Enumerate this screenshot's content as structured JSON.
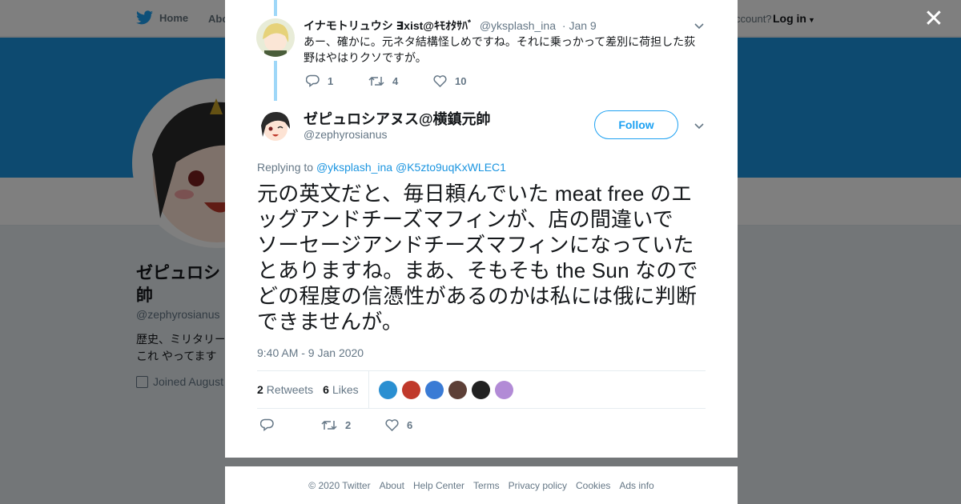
{
  "nav": {
    "home_label": "Home",
    "about_label": "Abo",
    "account_prompt": "ccount?",
    "login_label": "Log in"
  },
  "profile": {
    "display_name": "ゼピュロシ 帥",
    "handle": "@zephyrosianus",
    "bio_line1": "歴史、ミリタリー",
    "bio_line2": "これ やってます",
    "joined": "Joined August"
  },
  "reply_tweet": {
    "display_name": "イナモトリュウシ ∃xist@ｷﾓｵﾀｻﾊﾞ",
    "handle": "@yksplash_ina",
    "date": "· Jan 9",
    "text": "あー、確かに。元ネタ結構怪しめですね。それに乗っかって差別に荷担した荻野はやはりクソですが。",
    "replies": "1",
    "retweets": "4",
    "likes": "10"
  },
  "main_tweet": {
    "display_name": "ゼピュロシアヌス@横鎮元帥",
    "handle": "@zephyrosianus",
    "follow_label": "Follow",
    "replying_prefix": "Replying to",
    "replying_to_1": "@yksplash_ina",
    "replying_to_2": "@K5zto9uqKxWLEC1",
    "text": "元の英文だと、毎日頼んでいた meat free のエッグアンドチーズマフィンが、店の間違いで　ソーセージアンドチーズマフィンになっていたとありますね。まあ、そもそも the Sun なのでどの程度の信憑性があるのかは私には俄に判断できませんが。",
    "timestamp": "9:40 AM - 9 Jan 2020",
    "retweet_count": "2",
    "retweet_label": "Retweets",
    "like_count": "6",
    "like_label": "Likes",
    "action_retweets": "2",
    "action_likes": "6"
  },
  "liker_colors": [
    "#2a8fd1",
    "#c0392b",
    "#3a7bd5",
    "#5d4037",
    "#212121",
    "#b28bd6"
  ],
  "footer": {
    "copyright": "© 2020 Twitter",
    "about": "About",
    "help": "Help Center",
    "terms": "Terms",
    "privacy": "Privacy policy",
    "cookies": "Cookies",
    "ads": "Ads info"
  },
  "colors": {
    "brand": "#1da1f2",
    "banner": "#1b95e0",
    "thread_line": "#9ed7f8"
  }
}
